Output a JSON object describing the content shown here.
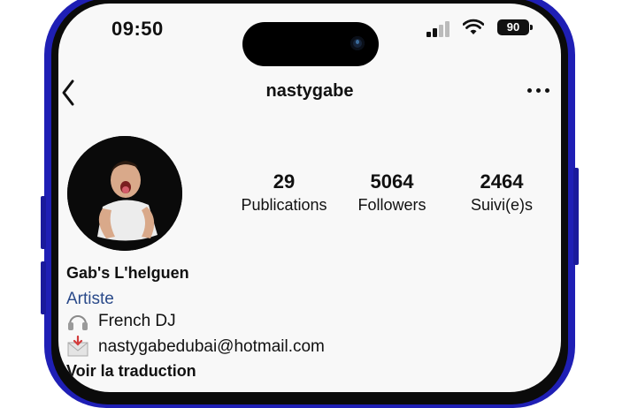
{
  "status_bar": {
    "time": "09:50",
    "battery": "90"
  },
  "header": {
    "username": "nastygabe"
  },
  "stats": [
    {
      "value": "29",
      "label": "Publications"
    },
    {
      "value": "5064",
      "label": "Followers"
    },
    {
      "value": "2464",
      "label": "Suivi(e)s"
    }
  ],
  "bio": {
    "name": "Gab's L'helguen",
    "category": "Artiste",
    "line1": "French DJ",
    "email": "nastygabedubai@hotmail.com",
    "translate": "Voir la traduction"
  },
  "icons": {
    "back": "chevron-left-icon",
    "more": "more-horizontal-icon",
    "headphones": "headphones-icon",
    "mail": "envelope-icon"
  },
  "colors": {
    "frame": "#1f1fb5",
    "category_link": "#2a4a8a",
    "screen_bg": "#f8f8f8"
  }
}
